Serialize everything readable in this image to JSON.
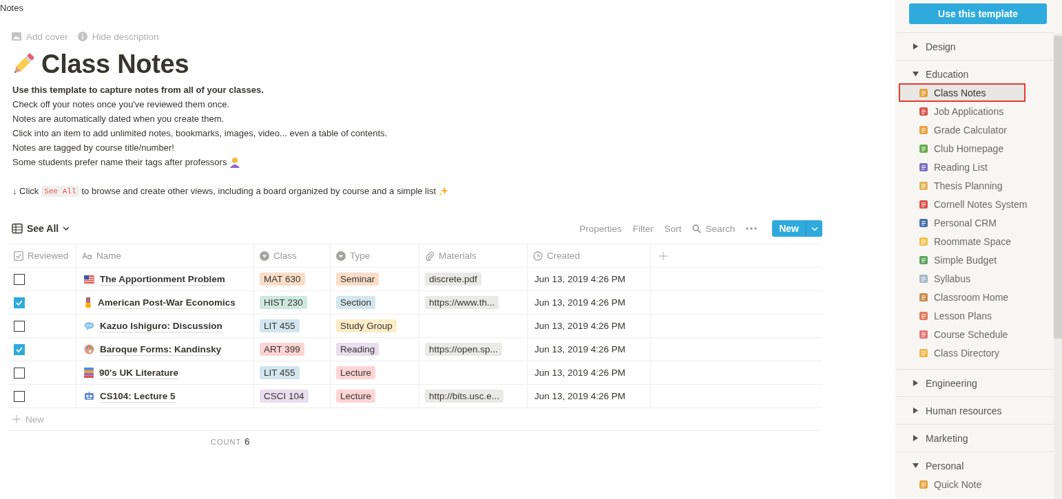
{
  "breadcrumb": "Notes",
  "page_actions": [
    {
      "kind": "cover",
      "label": "Add cover"
    },
    {
      "kind": "info",
      "label": "Hide description"
    }
  ],
  "title": "Class Notes",
  "description": {
    "lines": [
      "Use this template to capture notes from all of your classes.",
      "Check off your notes once you've reviewed them once.",
      "Notes are automatically dated when you create them.",
      "Click into an item to add unlimited notes, bookmarks, images, video... even a table of contents.",
      "Notes are tagged by course title/number!",
      "Some students prefer name their tags after professors"
    ],
    "hint": {
      "before": "↓ Click",
      "code": "See All",
      "after": "to browse and create other views, including a board organized by course and a simple list"
    }
  },
  "view": {
    "name": "See All",
    "actions": [
      "Properties",
      "Filter",
      "Sort"
    ],
    "search": "Search",
    "new_button": "New"
  },
  "table": {
    "columns": [
      {
        "kind": "checkbox",
        "label": "Reviewed"
      },
      {
        "kind": "title",
        "label": "Name"
      },
      {
        "kind": "select",
        "label": "Class"
      },
      {
        "kind": "select",
        "label": "Type"
      },
      {
        "kind": "files",
        "label": "Materials"
      },
      {
        "kind": "time",
        "label": "Created"
      }
    ],
    "rows": [
      {
        "reviewed": false,
        "name": "The Apportionment Problem",
        "class": {
          "label": "MAT 630",
          "color": "#fadec9"
        },
        "type": {
          "label": "Seminar",
          "color": "#fadec9"
        },
        "materials": "discrete.pdf",
        "created": "Jun 13, 2019 4:26 PM"
      },
      {
        "reviewed": true,
        "name": "American Post-War Economics",
        "class": {
          "label": "HIST 230",
          "color": "#cde8df"
        },
        "type": {
          "label": "Section",
          "color": "#d3e5ef"
        },
        "materials": "https://www.th...",
        "created": "Jun 13, 2019 4:26 PM"
      },
      {
        "reviewed": false,
        "name": "Kazuo Ishiguro: Discussion",
        "class": {
          "label": "LIT 455",
          "color": "#d3e5ef"
        },
        "type": {
          "label": "Study Group",
          "color": "#fdecc8"
        },
        "created": "Jun 13, 2019 4:26 PM"
      },
      {
        "reviewed": true,
        "name": "Baroque Forms: Kandinsky",
        "class": {
          "label": "ART 399",
          "color": "#ffd4d4"
        },
        "type": {
          "label": "Reading",
          "color": "#e8deee"
        },
        "materials": "https://open.sp...",
        "created": "Jun 13, 2019 4:26 PM"
      },
      {
        "reviewed": false,
        "name": "90's UK Literature",
        "class": {
          "label": "LIT 455",
          "color": "#d3e5ef"
        },
        "type": {
          "label": "Lecture",
          "color": "#ffd4d4"
        },
        "created": "Jun 13, 2019 4:26 PM"
      },
      {
        "reviewed": false,
        "name": "CS104: Lecture 5",
        "class": {
          "label": "CSCI 104",
          "color": "#e8deee"
        },
        "type": {
          "label": "Lecture",
          "color": "#ffd4d4"
        },
        "materials": "http://bits.usc.e...",
        "created": "Jun 13, 2019 4:26 PM"
      }
    ],
    "new_row": "New",
    "count_label": "COUNT",
    "count": "6"
  },
  "sidebar": {
    "button": "Use this template",
    "groups": [
      {
        "label": "Design",
        "expanded": false
      },
      {
        "label": "Education",
        "expanded": true,
        "items": [
          {
            "label": "Class Notes",
            "selected": true
          },
          {
            "label": "Job Applications",
            "selected": false
          },
          {
            "label": "Grade Calculator",
            "selected": false
          },
          {
            "label": "Club Homepage",
            "selected": false
          },
          {
            "label": "Reading List",
            "selected": false
          },
          {
            "label": "Thesis Planning",
            "selected": false
          },
          {
            "label": "Cornell Notes System",
            "selected": false
          },
          {
            "label": "Personal CRM",
            "selected": false
          },
          {
            "label": "Roommate Space",
            "selected": false
          },
          {
            "label": "Simple Budget",
            "selected": false
          },
          {
            "label": "Syllabus",
            "selected": false
          },
          {
            "label": "Classroom Home",
            "selected": false
          },
          {
            "label": "Lesson Plans",
            "selected": false
          },
          {
            "label": "Course Schedule",
            "selected": false
          },
          {
            "label": "Class Directory",
            "selected": false
          }
        ]
      },
      {
        "label": "Engineering",
        "expanded": false
      },
      {
        "label": "Human resources",
        "expanded": false
      },
      {
        "label": "Marketing",
        "expanded": false
      },
      {
        "label": "Personal",
        "expanded": true,
        "items": [
          {
            "label": "Quick Note",
            "selected": false
          }
        ]
      }
    ]
  }
}
